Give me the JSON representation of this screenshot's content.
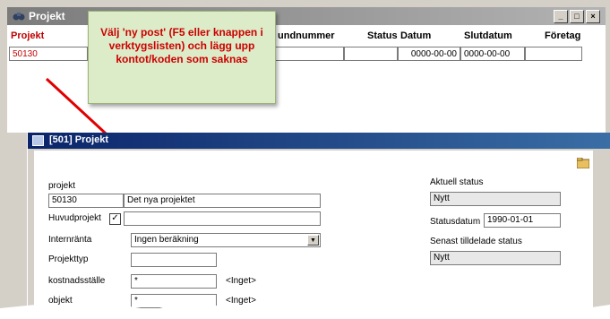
{
  "outer_window": {
    "title": "Projekt",
    "buttons": [
      "_",
      "□",
      "×"
    ]
  },
  "grid": {
    "headers": [
      "Projekt",
      "undnummer",
      "Status",
      "Datum",
      "Slutdatum",
      "Företag"
    ],
    "row": {
      "projekt": "50130",
      "datum": "0000-00-00",
      "slutdatum": "0000-00-00"
    }
  },
  "callout": {
    "text": "Välj 'ny post' (F5 eller knappen i verktygslisten) och lägg upp kontot/koden som saknas"
  },
  "inner_window": {
    "title": "[501] Projekt",
    "form": {
      "projekt_label": "projekt",
      "projekt_value": "50130",
      "name_value": "Det nya projektet",
      "huvudprojekt_label": "Huvudprojekt",
      "huvudprojekt_checked": "✓",
      "internranta_label": "Internränta",
      "internranta_value": "Ingen beräkning",
      "projekttyp_label": "Projekttyp",
      "kostnadsstalle_label": "kostnadsställe",
      "kostnadsstalle_value": "*",
      "kostnadsstalle_hint": "<Inget>",
      "objekt_label": "objekt",
      "objekt_value": "*",
      "objekt_hint": "<Inget>",
      "aktuell_status_label": "Aktuell status",
      "aktuell_status_value": "Nytt",
      "statusdatum_label": "Statusdatum",
      "statusdatum_value": "1990-01-01",
      "senast_label": "Senast tilldelade status",
      "senast_value": "Nytt"
    }
  },
  "colors": {
    "callout_bg": "#dcebc8",
    "callout_text": "#cc0000",
    "arrow": "#e00000",
    "inner_title": "#0a246a"
  }
}
